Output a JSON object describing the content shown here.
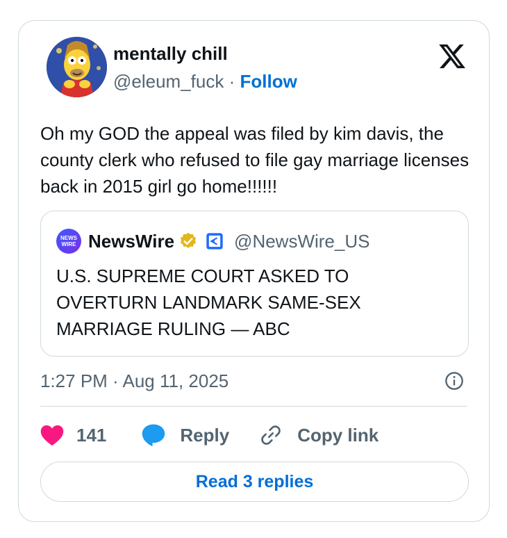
{
  "author": {
    "display_name": "mentally chill",
    "handle": "@eleum_fuck",
    "separator": "·",
    "follow_label": "Follow",
    "avatar_icon": "cartoon-avatar"
  },
  "tweet": {
    "text": "Oh my GOD the appeal was filed by kim davis, the county clerk who refused to file gay marriage licenses back in 2015 girl go home!!!!!!"
  },
  "quoted_tweet": {
    "logo_text": [
      "NEWS",
      "WIRE"
    ],
    "name": "NewsWire",
    "handle": "@NewsWire_US",
    "text": "U.S. SUPREME COURT ASKED TO OVERTURN LANDMARK SAME-SEX MARRIAGE RULING — ABC",
    "verified_badge": "gold-check-icon",
    "affiliate_badge": "affiliate-badge-icon"
  },
  "meta": {
    "timestamp": "1:27 PM · Aug 11, 2025"
  },
  "actions": {
    "likes_count": "141",
    "reply_label": "Reply",
    "copy_link_label": "Copy link"
  },
  "footer": {
    "read_replies_label": "Read 3 replies"
  },
  "colors": {
    "link_blue": "#006fd6",
    "like_pink": "#f91880",
    "reply_blue": "#1d9bf0",
    "muted_text": "#536471",
    "border": "#cfd9de",
    "verified_gold": "#e2b719"
  }
}
